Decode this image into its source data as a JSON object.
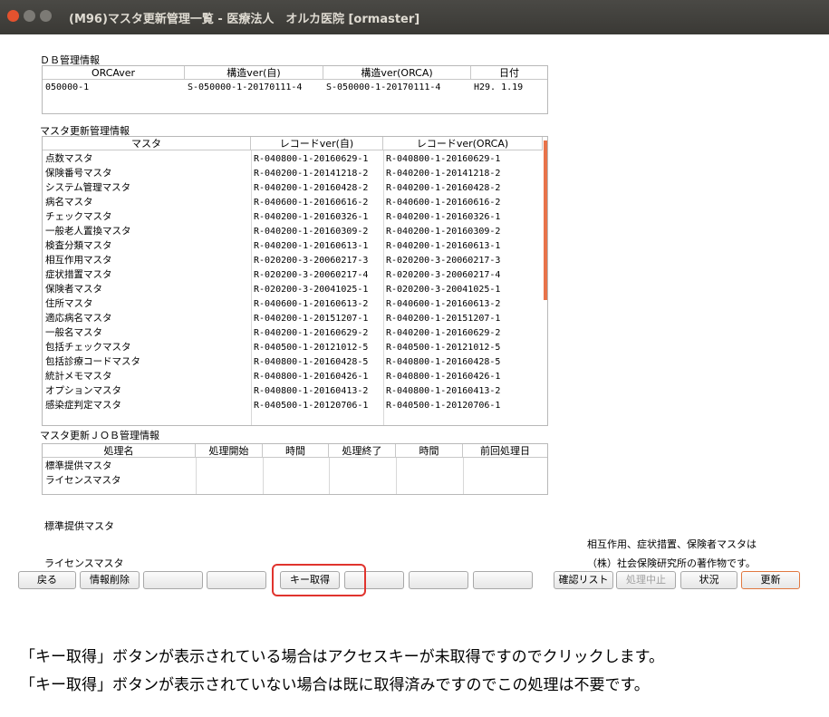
{
  "window": {
    "title": "(M96)マスタ更新管理一覧 - 医療法人　オルカ医院 [ormaster]",
    "colors": {
      "close": "#e3522e",
      "min": "#7c7a75",
      "max": "#7c7a75"
    }
  },
  "db_section": {
    "label": "ＤＢ管理情報",
    "headers": [
      "ORCAver",
      "構造ver(自)",
      "構造ver(ORCA)",
      "日付"
    ],
    "rows": [
      [
        "050000-1",
        "S-050000-1-20170111-4",
        "S-050000-1-20170111-4",
        "H29. 1.19"
      ]
    ]
  },
  "master_section": {
    "label": "マスタ更新管理情報",
    "headers": [
      "マスタ",
      "レコードver(自)",
      "レコードver(ORCA)"
    ],
    "rows": [
      [
        "点数マスタ",
        "R-040800-1-20160629-1",
        "R-040800-1-20160629-1"
      ],
      [
        "保険番号マスタ",
        "R-040200-1-20141218-2",
        "R-040200-1-20141218-2"
      ],
      [
        "システム管理マスタ",
        "R-040200-1-20160428-2",
        "R-040200-1-20160428-2"
      ],
      [
        "病名マスタ",
        "R-040600-1-20160616-2",
        "R-040600-1-20160616-2"
      ],
      [
        "チェックマスタ",
        "R-040200-1-20160326-1",
        "R-040200-1-20160326-1"
      ],
      [
        "一般老人置換マスタ",
        "R-040200-1-20160309-2",
        "R-040200-1-20160309-2"
      ],
      [
        "検査分類マスタ",
        "R-040200-1-20160613-1",
        "R-040200-1-20160613-1"
      ],
      [
        "相互作用マスタ",
        "R-020200-3-20060217-3",
        "R-020200-3-20060217-3"
      ],
      [
        "症状措置マスタ",
        "R-020200-3-20060217-4",
        "R-020200-3-20060217-4"
      ],
      [
        "保険者マスタ",
        "R-020200-3-20041025-1",
        "R-020200-3-20041025-1"
      ],
      [
        "住所マスタ",
        "R-040600-1-20160613-2",
        "R-040600-1-20160613-2"
      ],
      [
        "適応病名マスタ",
        "R-040200-1-20151207-1",
        "R-040200-1-20151207-1"
      ],
      [
        "一般名マスタ",
        "R-040200-1-20160629-2",
        "R-040200-1-20160629-2"
      ],
      [
        "包括チェックマスタ",
        "R-040500-1-20121012-5",
        "R-040500-1-20121012-5"
      ],
      [
        "包括診療コードマスタ",
        "R-040800-1-20160428-5",
        "R-040800-1-20160428-5"
      ],
      [
        "統計メモマスタ",
        "R-040800-1-20160426-1",
        "R-040800-1-20160426-1"
      ],
      [
        "オプションマスタ",
        "R-040800-1-20160413-2",
        "R-040800-1-20160413-2"
      ],
      [
        "感染症判定マスタ",
        "R-040500-1-20120706-1",
        "R-040500-1-20120706-1"
      ]
    ]
  },
  "job_section": {
    "label": "マスタ更新ＪＯＢ管理情報",
    "headers": [
      "処理名",
      "処理開始",
      "時間",
      "処理終了",
      "時間",
      "前回処理日"
    ],
    "rows": [
      [
        "標準提供マスタ",
        "",
        "",
        "",
        "",
        ""
      ],
      [
        "ライセンスマスタ",
        "",
        "",
        "",
        "",
        ""
      ]
    ]
  },
  "bottom": {
    "standard_label": "標準提供マスタ",
    "license_label": "ライセンスマスタ",
    "notice_line1": "相互作用、症状措置、保険者マスタは",
    "notice_line2": "（株）社会保険研究所の著作物です。"
  },
  "buttons": {
    "back": "戻る",
    "delete_info": "情報削除",
    "get_key": "キー取得",
    "confirm_list": "確認リスト",
    "stop_processing": "処理中止",
    "status": "状況",
    "update": "更新"
  },
  "instructions": {
    "line1": "「キー取得」ボタンが表示されている場合はアクセスキーが未取得ですのでクリックします。",
    "line2": "「キー取得」ボタンが表示されていない場合は既に取得済みですのでこの処理は不要です。"
  },
  "accent_colors": {
    "highlight": "#e0342e",
    "scrollbar": "#e8734a",
    "update_border": "#e07840"
  }
}
